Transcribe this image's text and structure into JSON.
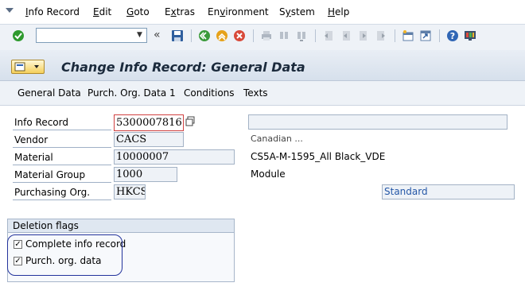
{
  "menu": {
    "items": [
      "Info Record",
      "Edit",
      "Goto",
      "Extras",
      "Environment",
      "System",
      "Help"
    ],
    "underline": [
      "I",
      "E",
      "G",
      "x",
      "v",
      "y",
      "H"
    ]
  },
  "toolbar": {
    "command_value": "",
    "collapse_glyph": "«",
    "icons": [
      "enter-icon",
      "save-icon",
      "back-icon",
      "exit-icon",
      "cancel-icon",
      "print-icon",
      "find-icon",
      "find-next-icon",
      "first-page-icon",
      "previous-page-icon",
      "next-page-icon",
      "last-page-icon",
      "create-session-icon",
      "shortcut-icon",
      "help-icon",
      "customize-layout-icon"
    ]
  },
  "title": {
    "text": "Change Info Record: General Data"
  },
  "app_toolbar": {
    "buttons": [
      "General Data",
      "Purch. Org. Data 1",
      "Conditions",
      "Texts"
    ]
  },
  "form": {
    "info_record": {
      "label": "Info Record",
      "value": "5300007816"
    },
    "vendor": {
      "label": "Vendor",
      "value": "CACS",
      "description": "Canadian ..."
    },
    "material": {
      "label": "Material",
      "value": "10000007",
      "description": "CS5A-M-1595_All Black_VDE"
    },
    "material_group": {
      "label": "Material Group",
      "value": "1000",
      "description": "Module"
    },
    "purchasing_org": {
      "label": "Purchasing Org.",
      "value": "HKCS",
      "description": "Standard"
    }
  },
  "deletion_flags": {
    "title": "Deletion flags",
    "complete_info_record": {
      "label": "Complete info record",
      "checked": true
    },
    "purch_org_data": {
      "label": "Purch. org. data",
      "checked": true
    }
  },
  "colors": {
    "title_text": "#1b2a3c",
    "highlight_ring": "#23339c",
    "input_border": "#d04040",
    "standard_text": "#2557a7"
  }
}
